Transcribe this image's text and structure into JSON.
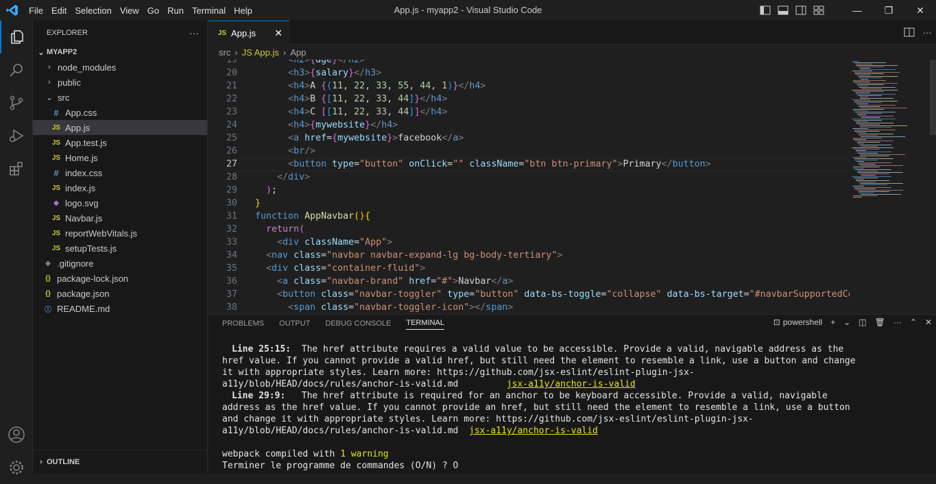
{
  "titlebar": {
    "menus": [
      "File",
      "Edit",
      "Selection",
      "View",
      "Go",
      "Run",
      "Terminal",
      "Help"
    ],
    "window_title": "App.js - myapp2 - Visual Studio Code",
    "logo": "vscode-logo"
  },
  "explorer": {
    "header": "EXPLORER",
    "more": "···",
    "root": "MYAPP2",
    "items": [
      {
        "label": "node_modules",
        "type": "folder",
        "expanded": false
      },
      {
        "label": "public",
        "type": "folder",
        "expanded": false
      },
      {
        "label": "src",
        "type": "folder",
        "expanded": true
      },
      {
        "label": "App.css",
        "type": "css",
        "glyph": "#"
      },
      {
        "label": "App.js",
        "type": "js",
        "glyph": "JS",
        "selected": true
      },
      {
        "label": "App.test.js",
        "type": "js",
        "glyph": "JS"
      },
      {
        "label": "Home.js",
        "type": "js",
        "glyph": "JS"
      },
      {
        "label": "index.css",
        "type": "css",
        "glyph": "#"
      },
      {
        "label": "index.js",
        "type": "js",
        "glyph": "JS"
      },
      {
        "label": "logo.svg",
        "type": "svg",
        "glyph": "◆"
      },
      {
        "label": "Navbar.js",
        "type": "js",
        "glyph": "JS"
      },
      {
        "label": "reportWebVitals.js",
        "type": "js",
        "glyph": "JS"
      },
      {
        "label": "setupTests.js",
        "type": "js",
        "glyph": "JS"
      },
      {
        "label": ".gitignore",
        "type": "git",
        "glyph": "◆"
      },
      {
        "label": "package-lock.json",
        "type": "json",
        "glyph": "{}"
      },
      {
        "label": "package.json",
        "type": "json",
        "glyph": "{}"
      },
      {
        "label": "README.md",
        "type": "info",
        "glyph": "ⓘ"
      }
    ],
    "outline": "OUTLINE"
  },
  "editor": {
    "tab_label": "App.js",
    "tab_glyph": "JS",
    "breadcrumbs": [
      "src",
      "›",
      "JS App.js",
      "›",
      "App"
    ],
    "current_line": 27,
    "line_numbers": [
      19,
      20,
      21,
      22,
      23,
      24,
      25,
      26,
      27,
      28,
      29,
      30,
      31,
      32,
      33,
      34,
      35,
      36,
      37,
      38
    ]
  },
  "panel": {
    "tabs": [
      "PROBLEMS",
      "OUTPUT",
      "DEBUG CONSOLE",
      "TERMINAL"
    ],
    "active_tab": "TERMINAL",
    "shell": "powershell",
    "terminal": {
      "l1_loc": "Line 25:15:",
      "l1_text": "  The href attribute requires a valid value to be accessible. Provide a valid, navigable address as the href value. If you cannot provide a valid href, but still need the element to resemble a link, use a button and change it with appropriate styles. Learn more: https://github.com/jsx-eslint/eslint-plugin-jsx-a11y/blob/HEAD/docs/rules/anchor-is-valid.md         ",
      "l1_rule": "jsx-a11y/anchor-is-valid",
      "l2_loc": "Line 29:9:",
      "l2_text": "   The href attribute is required for an anchor to be keyboard accessible. Provide a valid, navigable address as the href value. If you cannot provide an href, but still need the element to resemble a link, use a button and change it with appropriate styles. Learn more: https://github.com/jsx-eslint/eslint-plugin-jsx-a11y/blob/HEAD/docs/rules/anchor-is-valid.md  ",
      "l2_rule": "jsx-a11y/anchor-is-valid",
      "compiled_prefix": "webpack compiled with ",
      "compiled_warn": "1 warning",
      "prompt": "Terminer le programme de commandes (O/N) ? O"
    }
  }
}
